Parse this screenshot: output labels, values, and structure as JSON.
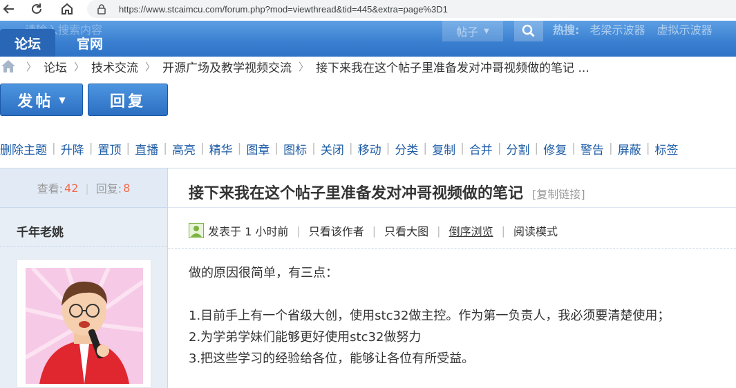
{
  "browser": {
    "url": "https://www.stcaimcu.com/forum.php?mod=viewthread&tid=445&extra=page%3D1",
    "icons": [
      "back-icon",
      "reload-icon",
      "home-icon",
      "lock-icon"
    ]
  },
  "header": {
    "search_placeholder": "请输入搜索内容",
    "tabs": [
      "论坛",
      "官网"
    ],
    "search_scope": "帖子",
    "hot_label": "热搜:",
    "hot_terms": [
      "老梁示波器",
      "虚拟示波器"
    ],
    "colors": {
      "bar": "#3a7fd0",
      "active_tab": "#2966b6"
    }
  },
  "breadcrumb": [
    "论坛",
    "技术交流",
    "开源广场及教学视频交流",
    "接下来我在这个帖子里准备发对冲哥视频做的笔记 ..."
  ],
  "actions": {
    "post": "发帖",
    "reply": "回复"
  },
  "moderation": [
    "删除主题",
    "升降",
    "置顶",
    "直播",
    "高亮",
    "精华",
    "图章",
    "图标",
    "关闭",
    "移动",
    "分类",
    "复制",
    "合并",
    "分割",
    "修复",
    "警告",
    "屏蔽",
    "标签"
  ],
  "thread": {
    "views_label": "查看:",
    "views": "42",
    "replies_label": "回复:",
    "replies": "8",
    "title": "接下来我在这个帖子里准备发对冲哥视频做的笔记",
    "copy_link": "[复制链接]",
    "author": "千年老姚",
    "posted": "发表于 1 小时前",
    "meta_links": [
      "只看该作者",
      "只看大图",
      "倒序浏览",
      "阅读模式"
    ],
    "content": [
      "做的原因很简单，有三点：",
      "",
      "1.目前手上有一个省级大创，使用stc32做主控。作为第一负责人，我必须要清楚使用；",
      "2.为学弟学妹们能够更好使用stc32做努力",
      "3.把这些学习的经验给各位，能够让各位有所受益。"
    ],
    "accent_number_color": "#f26c4f",
    "link_color": "#1d5ca6"
  }
}
